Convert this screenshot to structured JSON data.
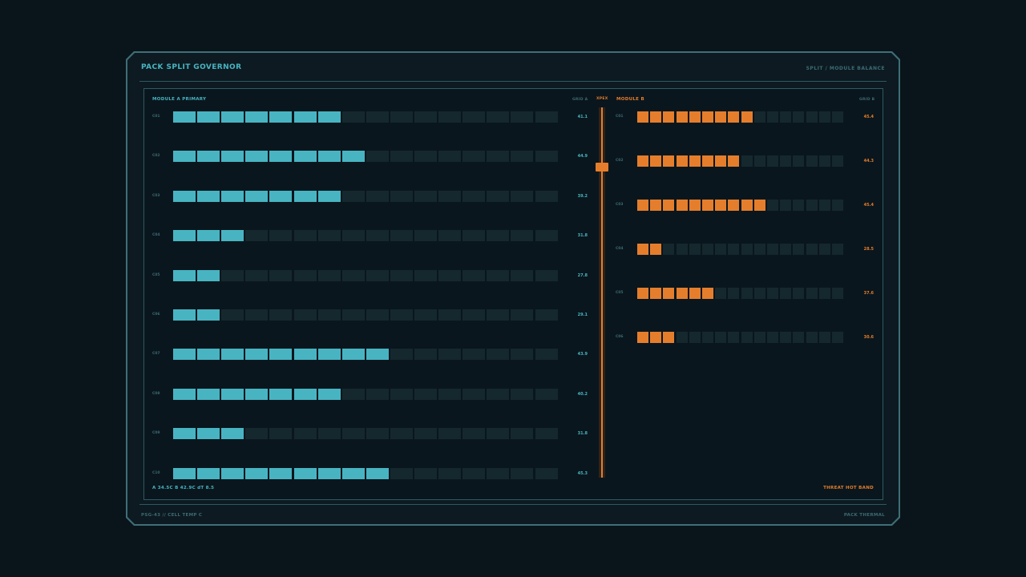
{
  "header": {
    "title": "PACK SPLIT GOVERNOR",
    "mode": "SPLIT / MODULE BALANCE"
  },
  "footer": {
    "left": "PSG-43 // CELL TEMP C",
    "right": "PACK THERMAL"
  },
  "colors": {
    "module_a": "#48b4c2",
    "module_b": "#e57e2c",
    "empty_segment": "#15282e",
    "accent_dim": "#3d6a72"
  },
  "module_a": {
    "label": "MODULE A  PRIMARY",
    "grid_label": "GRID A",
    "segments_total": 16,
    "cells": [
      {
        "label": "C01",
        "value": "41.1",
        "filled": 7
      },
      {
        "label": "C02",
        "value": "44.9",
        "filled": 8
      },
      {
        "label": "C03",
        "value": "39.2",
        "filled": 7
      },
      {
        "label": "C04",
        "value": "31.8",
        "filled": 3
      },
      {
        "label": "C05",
        "value": "27.8",
        "filled": 2
      },
      {
        "label": "C06",
        "value": "29.1",
        "filled": 2
      },
      {
        "label": "C07",
        "value": "43.9",
        "filled": 9
      },
      {
        "label": "C08",
        "value": "40.2",
        "filled": 7
      },
      {
        "label": "C09",
        "value": "31.8",
        "filled": 3
      },
      {
        "label": "C10",
        "value": "45.3",
        "filled": 9
      }
    ],
    "summary": "A 34.5C  B 42.9C  dT 8.5"
  },
  "split": {
    "label": "XPEX",
    "position": 0.16
  },
  "module_b": {
    "label": "MODULE B",
    "grid_label": "GRID B",
    "segments_total": 16,
    "cells": [
      {
        "label": "C01",
        "value": "45.4",
        "filled": 9
      },
      {
        "label": "C02",
        "value": "44.3",
        "filled": 8
      },
      {
        "label": "C03",
        "value": "45.4",
        "filled": 10
      },
      {
        "label": "C04",
        "value": "28.5",
        "filled": 2
      },
      {
        "label": "C05",
        "value": "37.6",
        "filled": 6
      },
      {
        "label": "C06",
        "value": "30.6",
        "filled": 3
      }
    ],
    "status": "THREAT  HOT BAND"
  }
}
